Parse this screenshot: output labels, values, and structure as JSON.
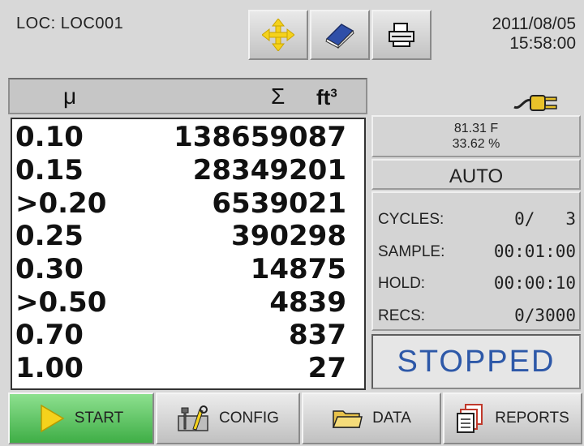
{
  "header": {
    "location": "LOC:  LOC001",
    "date": "2011/08/05",
    "time": "15:58:00"
  },
  "toolbar": {
    "move_icon": "move-arrows-icon",
    "book_icon": "book-icon",
    "print_icon": "printer-icon"
  },
  "table": {
    "headers": {
      "size": "μ",
      "sum": "Σ",
      "unit": "ft",
      "unit_exp": "3"
    },
    "rows": [
      {
        "size": "0.10",
        "count": "138659087"
      },
      {
        "size": "0.15",
        "count": "28349201"
      },
      {
        "size": ">0.20",
        "count": "6539021"
      },
      {
        "size": "0.25",
        "count": "390298"
      },
      {
        "size": "0.30",
        "count": "14875"
      },
      {
        "size": ">0.50",
        "count": "4839"
      },
      {
        "size": "0.70",
        "count": "837"
      },
      {
        "size": "1.00",
        "count": "27"
      }
    ]
  },
  "environment": {
    "temperature": "81.31  F",
    "humidity": "33.62  %"
  },
  "mode": "AUTO",
  "stats": {
    "cycles_label": "CYCLES:",
    "cycles_value": "0/   3",
    "sample_label": "SAMPLE:",
    "sample_value": "00:01:00",
    "hold_label": "HOLD:",
    "hold_value": "00:00:10",
    "recs_label": "RECS:",
    "recs_value": "0/3000"
  },
  "status": "STOPPED",
  "nav": {
    "start": "START",
    "config": "CONFIG",
    "data": "DATA",
    "reports": "REPORTS"
  },
  "colors": {
    "status_text": "#2d58a8",
    "start_button": "#4cbc52",
    "icon_yellow": "#f5d21c"
  }
}
